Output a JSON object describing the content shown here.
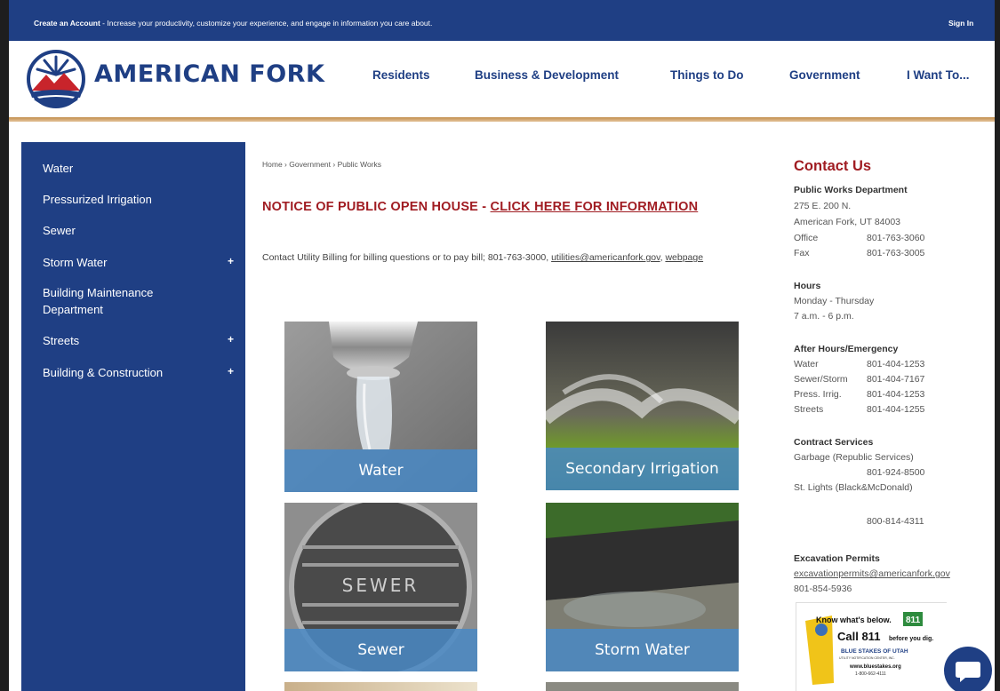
{
  "topbar": {
    "create_account": "Create an Account",
    "message": " - Increase your productivity, customize your experience, and engage in information you care about.",
    "sign_in": "Sign In"
  },
  "header": {
    "brand": "AMERICAN FORK",
    "nav": [
      "Residents",
      "Business & Development",
      "Things to Do",
      "Government",
      "I Want To..."
    ]
  },
  "colors": {
    "primary": "#1f3f84",
    "accent_red": "#a01c22",
    "tile_label": "#4988c4",
    "rule_gold": "#c28e4c"
  },
  "sidebar": {
    "items": [
      {
        "label": "Water",
        "expandable": false
      },
      {
        "label": "Pressurized Irrigation",
        "expandable": false
      },
      {
        "label": "Sewer",
        "expandable": false
      },
      {
        "label": "Storm Water",
        "expandable": true
      },
      {
        "label": "Building Maintenance Department",
        "expandable": false
      },
      {
        "label": "Streets",
        "expandable": true
      },
      {
        "label": "Building & Construction",
        "expandable": true
      }
    ],
    "plus": "+"
  },
  "breadcrumb": {
    "home": "Home",
    "sep": " › ",
    "government": "Government",
    "current": "Public Works"
  },
  "notice": {
    "prefix": "NOTICE OF PUBLIC OPEN HOUSE - ",
    "link": "CLICK HERE FOR INFORMATION"
  },
  "billing": {
    "text": "Contact Utility Billing for billing questions or to pay bill; 801-763-3000, ",
    "email": "utilities@americanfork.gov",
    "sep": ", ",
    "webpage": "webpage"
  },
  "tiles": [
    "Water",
    "Secondary Irrigation",
    "Sewer",
    "Storm Water"
  ],
  "manhole_text": "SEWER",
  "contact": {
    "title": "Contact Us",
    "department": "Public Works Department",
    "address1": "275 E. 200 N.",
    "address2": "American Fork, UT 84003",
    "office_label": "Office",
    "office_phone": "801-763-3060",
    "fax_label": "Fax",
    "fax_phone": "801-763-3005",
    "hours_title": "Hours",
    "hours_days": "Monday - Thursday",
    "hours_time": "7 a.m. - 6 p.m.",
    "after_title": "After Hours/Emergency",
    "after": [
      {
        "label": "Water",
        "phone": "801-404-1253"
      },
      {
        "label": "Sewer/Storm",
        "phone": "801-404-7167"
      },
      {
        "label": "Press. Irrig.",
        "phone": "801-404-1253"
      },
      {
        "label": "Streets",
        "phone": "801-404-1255"
      }
    ],
    "contract_title": "Contract Services",
    "garbage": "Garbage (Republic Services)",
    "garbage_phone": "801-924-8500",
    "lights": "St. Lights (Black&McDonald)",
    "lights_phone": "800-814-4311",
    "excavation_title": "Excavation Permits",
    "excavation_email": "excavationpermits@americanfork.gov",
    "excavation_phone": "801-854-5936"
  },
  "banner811": {
    "line1": "Know what's below.",
    "badge": "811",
    "line2": "Call 811",
    "line2_small": "before you dig.",
    "org": "BLUE STAKES OF UTAH",
    "org_sub": "UTILITY NOTIFICATION CENTER, INC.",
    "web": "www.bluestakes.org",
    "phone": "1-800-662-4111"
  }
}
